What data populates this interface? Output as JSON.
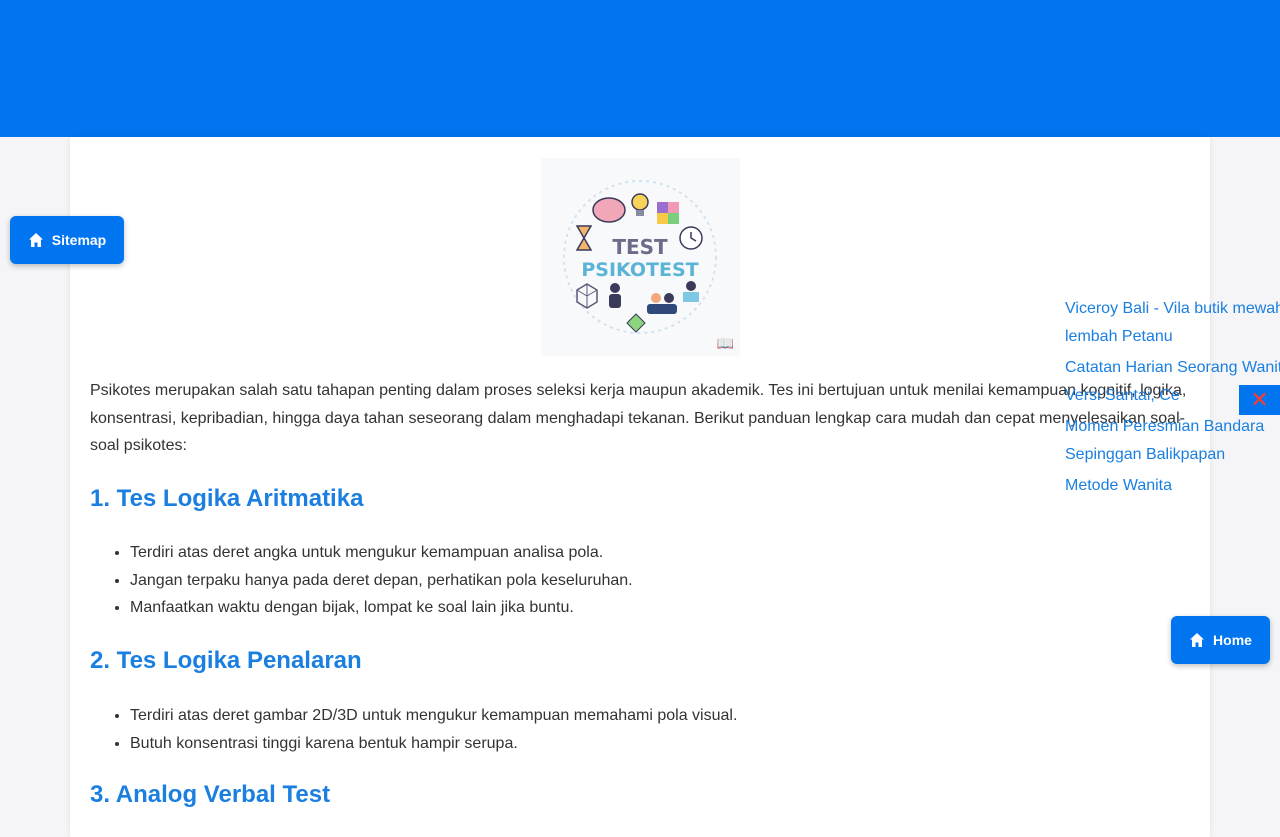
{
  "colors": {
    "brand": "#0174ef",
    "heading": "#1a7fe0",
    "close": "#ff3b30"
  },
  "hero": {
    "line1": "TEST",
    "line2": "PSIKOTEST",
    "book_icon": "open-book-icon"
  },
  "intro": "Psikotes merupakan salah satu tahapan penting dalam proses seleksi kerja maupun akademik. Tes ini bertujuan untuk menilai kemampuan kognitif, logika, konsentrasi, kepribadian, hingga daya tahan seseorang dalam menghadapi tekanan. Berikut panduan lengkap cara mudah dan cepat menyelesaikan soal-soal psikotes:",
  "sections": [
    {
      "title": "1. Tes Logika Aritmatika",
      "points": [
        "Terdiri atas deret angka untuk mengukur kemampuan analisa pola.",
        "Jangan terpaku hanya pada deret depan, perhatikan pola keseluruhan.",
        "Manfaatkan waktu dengan bijak, lompat ke soal lain jika buntu."
      ]
    },
    {
      "title": "2. Tes Logika Penalaran",
      "points": [
        "Terdiri atas deret gambar 2D/3D untuk mengukur kemampuan memahami pola visual.",
        "Butuh konsentrasi tinggi karena bentuk hampir serupa."
      ]
    },
    {
      "title": "3. Analog Verbal Test",
      "points": []
    }
  ],
  "floating": {
    "sitemap_label": "Sitemap",
    "home_label": "Home",
    "close_symbol": "✕"
  },
  "popup_links": [
    "Viceroy Bali - Vila butik mewah di lembah Petanu",
    "Catatan Harian Seorang Wanita - Versi Santai, Ce",
    "Momen Peresmian Bandara Sepinggan Balikpapan",
    "Metode Wanita"
  ]
}
